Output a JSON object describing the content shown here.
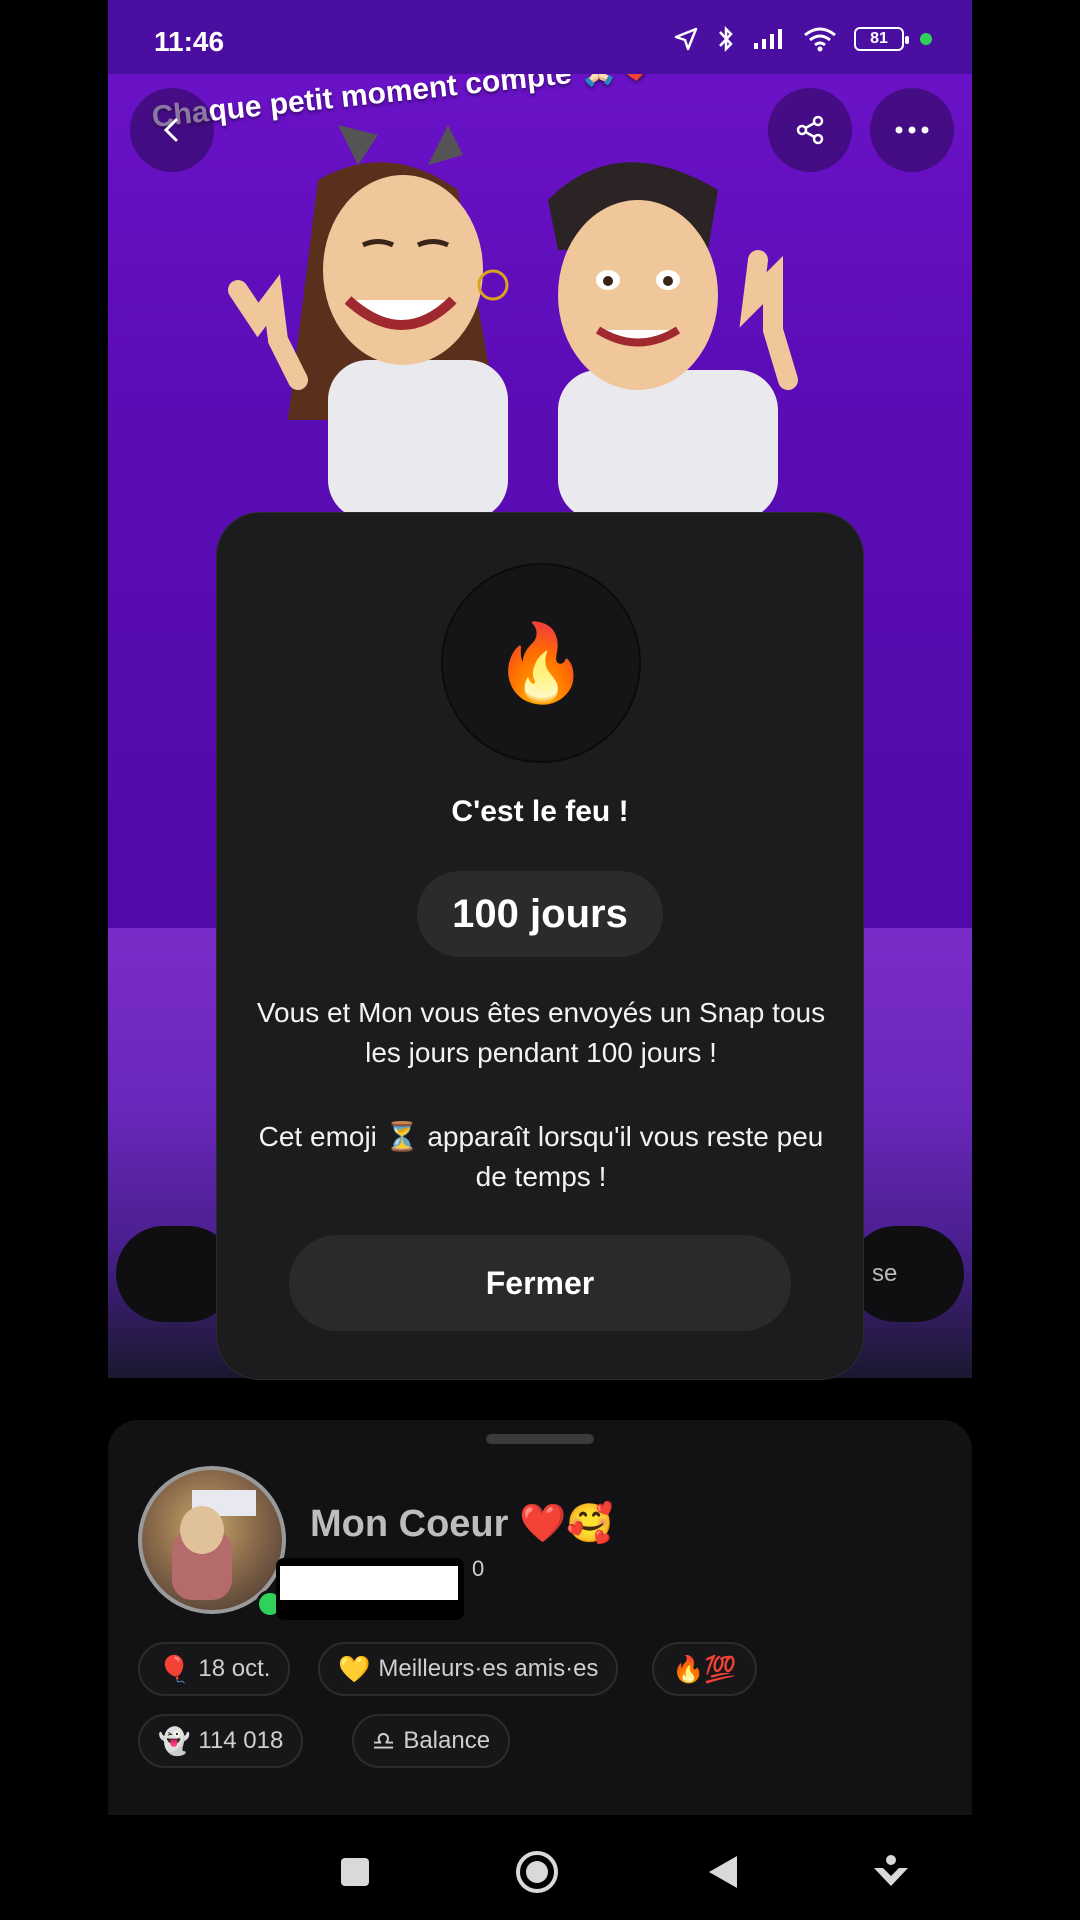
{
  "status_bar": {
    "time": "11:46",
    "battery": "81"
  },
  "hero": {
    "caption": "Chaque petit moment compte 🙏🏻❤️"
  },
  "background_buttons": {
    "right_partial_label": "se"
  },
  "modal": {
    "emoji": "🔥",
    "title": "C'est le feu !",
    "days_label": "100 jours",
    "text_1": "Vous et Mon vous êtes envoyés un Snap tous les jours pendant 100 jours !",
    "text_2": "Cet emoji ⏳ apparaît lorsqu'il vous reste peu de temps !",
    "close_label": "Fermer"
  },
  "profile": {
    "name": "Mon Coeur ❤️🥰",
    "score_suffix": "0",
    "chips": [
      {
        "emoji": "🎈",
        "label": "18 oct."
      },
      {
        "emoji": "💛",
        "label": "Meilleurs·es amis·es"
      },
      {
        "emoji": "🔥💯",
        "label": ""
      },
      {
        "emoji": "👻",
        "label": "114 018"
      },
      {
        "emoji": "♎",
        "label": "Balance"
      }
    ]
  },
  "icons": {
    "back": "chevron-left-icon",
    "share": "share-icon",
    "more": "more-horizontal-icon",
    "nav": [
      "recents-square-icon",
      "home-circle-icon",
      "back-triangle-icon",
      "assistant-icon"
    ]
  },
  "colors": {
    "accent_purple": "#6a12c7",
    "modal_bg": "#1c1c1e",
    "online": "#2fd15b"
  }
}
